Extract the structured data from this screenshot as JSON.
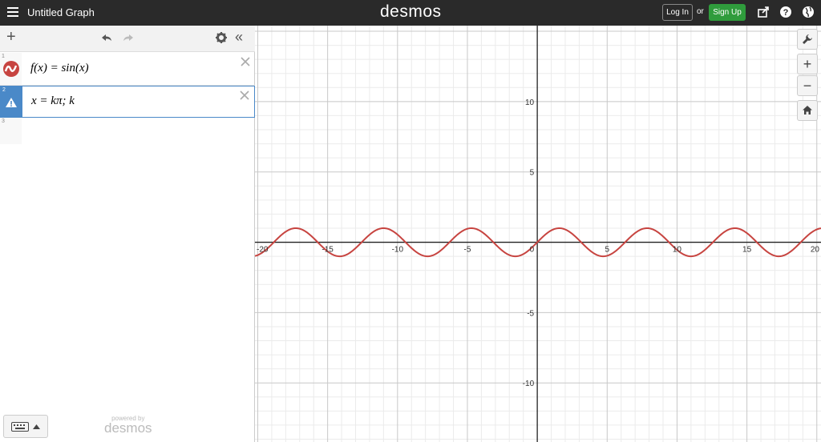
{
  "app": {
    "title": "Untitled Graph",
    "brand": "desmos",
    "login_label": "Log In",
    "or_label": "or",
    "signup_label": "Sign Up"
  },
  "expressions": [
    {
      "index": "1",
      "latex": "f(x) = sin(x)",
      "color": "#c74440"
    },
    {
      "index": "2",
      "latex": "x = kπ; k",
      "status": "warning"
    },
    {
      "index": "3",
      "latex": ""
    }
  ],
  "footer": {
    "powered_by": "powered by",
    "brand": "desmos"
  },
  "graph": {
    "x_range": [
      -20.2,
      20.3
    ],
    "y_range": [
      -14.2,
      15.4
    ],
    "x_ticks": [
      "-20",
      "-15",
      "-10",
      "-5",
      "0",
      "5",
      "10",
      "15",
      "20"
    ],
    "y_ticks": [
      "10",
      "5",
      "-5",
      "-10"
    ],
    "curve_color": "#c74440",
    "grid": true
  },
  "chart_data": {
    "type": "line",
    "series": [
      {
        "name": "f(x) = sin(x)",
        "function": "sin(x)",
        "x_range": [
          -20.2,
          20.3
        ]
      }
    ],
    "xlim": [
      -20.2,
      20.3
    ],
    "ylim": [
      -14.2,
      15.4
    ]
  }
}
